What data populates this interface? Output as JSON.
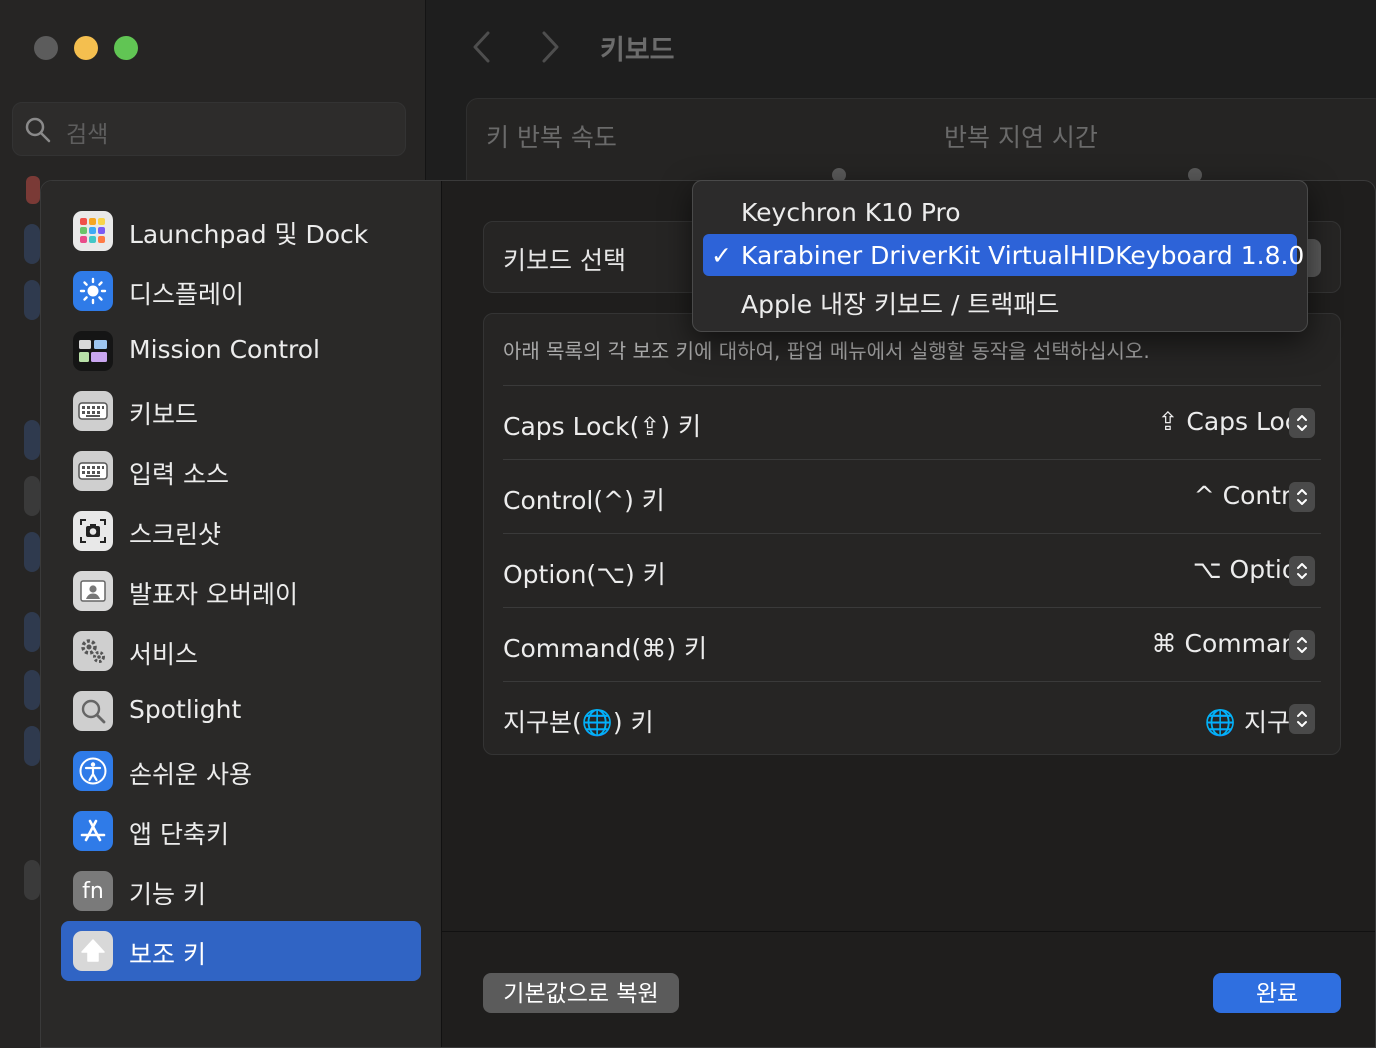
{
  "window": {
    "title": "키보드",
    "search_placeholder": "검색",
    "traffic_colors": [
      "#5c5c5c",
      "#f4bf4f",
      "#61c554"
    ],
    "nav_back_icon": "chevron-left-icon",
    "nav_forward_icon": "chevron-right-icon"
  },
  "background_panel": {
    "key_repeat_label": "키 반복 속도",
    "repeat_delay_label": "반복 지연 시간"
  },
  "sidebar": {
    "items": [
      {
        "label": "Launchpad 및 Dock",
        "icon": "launchpad-grid-icon",
        "selected": false
      },
      {
        "label": "디스플레이",
        "icon": "sun-brightness-icon",
        "selected": false
      },
      {
        "label": "Mission Control",
        "icon": "mission-control-icon",
        "selected": false
      },
      {
        "label": "키보드",
        "icon": "keyboard-icon",
        "selected": false
      },
      {
        "label": "입력 소스",
        "icon": "keyboard-input-icon",
        "selected": false
      },
      {
        "label": "스크린샷",
        "icon": "camera-screenshot-icon",
        "selected": false
      },
      {
        "label": "발표자 오버레이",
        "icon": "presenter-overlay-icon",
        "selected": false
      },
      {
        "label": "서비스",
        "icon": "gears-icon",
        "selected": false
      },
      {
        "label": "Spotlight",
        "icon": "magnifier-icon",
        "selected": false
      },
      {
        "label": "손쉬운 사용",
        "icon": "accessibility-icon",
        "selected": false
      },
      {
        "label": "앱 단축키",
        "icon": "app-store-icon",
        "selected": false
      },
      {
        "label": "기능 키",
        "icon": "fn-key-icon",
        "selected": false
      },
      {
        "label": "보조 키",
        "icon": "modifier-key-arrow-icon",
        "selected": true
      }
    ]
  },
  "keyboard_select": {
    "label": "키보드 선택",
    "options": [
      {
        "label": "Keychron K10 Pro",
        "selected": false
      },
      {
        "label": "Karabiner DriverKit VirtualHIDKeyboard 1.8.0",
        "selected": true
      },
      {
        "label": "Apple 내장 키보드 / 트랙패드",
        "selected": false
      }
    ],
    "check_mark": "✓"
  },
  "modifiers": {
    "description": "아래 목록의 각 보조 키에 대하여, 팝업 메뉴에서 실행할 동작을 선택하십시오.",
    "rows": [
      {
        "label": "Caps Lock(⇪) 키",
        "value": "⇪ Caps Lock"
      },
      {
        "label": "Control(^) 키",
        "value": "^ Control"
      },
      {
        "label": "Option(⌥) 키",
        "value": "⌥ Option"
      },
      {
        "label": "Command(⌘) 키",
        "value": "⌘ Command"
      },
      {
        "label": "지구본(🌐) 키",
        "value": "🌐 지구본"
      }
    ]
  },
  "footer": {
    "restore_label": "기본값으로 복원",
    "done_label": "완료"
  },
  "colors": {
    "accent": "#3064c4",
    "done_button": "#2f6fe0",
    "menu_highlight": "#2d63d8"
  }
}
